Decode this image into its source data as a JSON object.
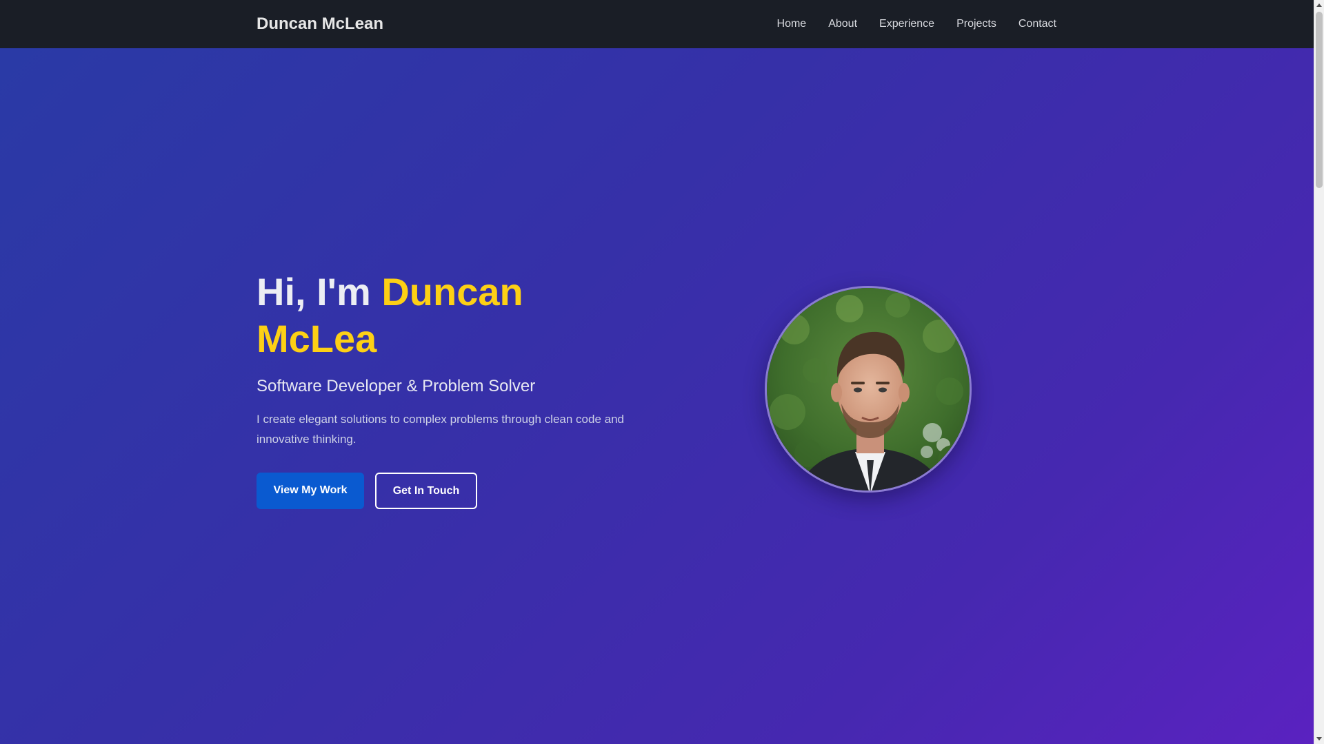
{
  "nav": {
    "brand": "Duncan McLean",
    "links": [
      {
        "label": "Home"
      },
      {
        "label": "About"
      },
      {
        "label": "Experience"
      },
      {
        "label": "Projects"
      },
      {
        "label": "Contact"
      }
    ]
  },
  "hero": {
    "greeting": "Hi, I'm ",
    "name_line1": "Duncan",
    "name_line2": "McLea",
    "subtitle": "Software Developer & Problem Solver",
    "description": "I create elegant solutions to complex problems through clean code and innovative thinking.",
    "primary_button": "View My Work",
    "secondary_button": "Get In Touch",
    "avatar_icon": "profile-photo"
  },
  "colors": {
    "nav_bg": "#1a1e26",
    "accent_yellow": "#fdd015",
    "primary_blue": "#0a5ad0",
    "gradient_start": "#2a3aa6",
    "gradient_end": "#5a22c0"
  }
}
